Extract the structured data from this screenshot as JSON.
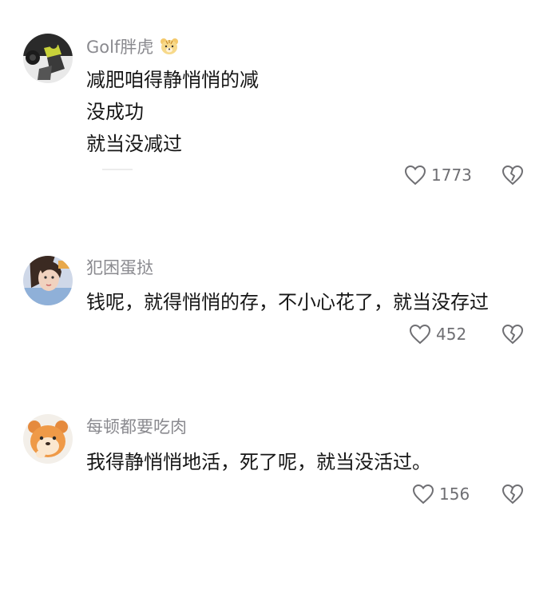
{
  "comments": [
    {
      "username": "Golf胖虎",
      "username_emoji": "tiger-face-emoji",
      "lines": [
        "减肥咱得静悄悄的减",
        "没成功",
        "就当没减过"
      ],
      "likes": "1773"
    },
    {
      "username": "犯困蛋挞",
      "lines": [
        "钱呢，就得悄悄的存，不小心花了，就当没存过"
      ],
      "likes": "452"
    },
    {
      "username": "每顿都要吃肉",
      "lines": [
        "我得静悄悄地活，死了呢，就当没活过。"
      ],
      "likes": "156"
    }
  ],
  "icons": {
    "like": "heart-outline-icon",
    "dislike": "broken-heart-icon"
  },
  "colors": {
    "background": "#ffffff",
    "username": "#8a8a8f",
    "text": "#161616",
    "icon": "#6f6f73"
  }
}
